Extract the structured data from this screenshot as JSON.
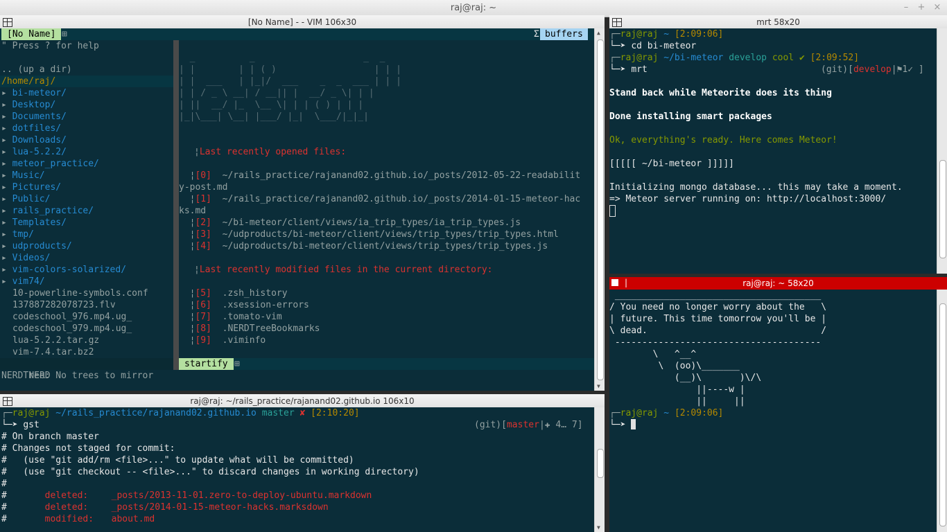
{
  "window": {
    "title": "raj@raj: ~",
    "buttons": [
      "–",
      "+",
      "×"
    ]
  },
  "vim_pane": {
    "title": "[No Name] - - VIM 106x30",
    "top_tab": "[No Name]",
    "buffers_label": "buffers",
    "nerd": {
      "help": "\" Press ? for help",
      "updir": ".. (up a dir)",
      "root": "/home/raj/",
      "dirs": [
        "bi-meteor/",
        "Desktop/",
        "Documents/",
        "dotfiles/",
        "Downloads/",
        "lua-5.2.2/",
        "meteor_practice/",
        "Music/",
        "Pictures/",
        "Public/",
        "rails_practice/",
        "Templates/",
        "tmp/",
        "udproducts/",
        "Videos/",
        "vim-colors-solarized/",
        "vim74/"
      ],
      "files": [
        "10-powerline-symbols.conf",
        "137887282078723.flv",
        "codeschool_976.mp4.ug_",
        "codeschool_979.mp4.ug_",
        "lua-5.2.2.tar.gz",
        "vim-7.4.tar.bz2"
      ],
      "status": "NERD"
    },
    "startify": {
      "banner": [
        "  _          _                    _  _",
        "| |        | | ( )                  | | |",
        "| |  ___   | |_|/  ___    _  _  ___ | | |",
        "| | / _ \\ __| / __|| |  __/ _ \\| | |",
        "| ||  __/ |_  \\__ \\| | | ( ) | | |",
        "|_|\\___| \\__| |___/ |_|  \\___/|_|_|"
      ],
      "recent_header": "Last recently opened files:",
      "recent": [
        {
          "idx": "[0]",
          "text": "~/rails_practice/rajanand02.github.io/_posts/2012-05-22-readabilit"
        },
        {
          "idx": "",
          "text": "y-post.md"
        },
        {
          "idx": "[1]",
          "text": "~/rails_practice/rajanand02.github.io/_posts/2014-01-15-meteor-hac"
        },
        {
          "idx": "",
          "text": "ks.md"
        },
        {
          "idx": "[2]",
          "text": "~/bi-meteor/client/views/ia_trip_types/ia_trip_types.js"
        },
        {
          "idx": "[3]",
          "text": "~/udproducts/bi-meteor/client/views/trip_types/trip_types.html"
        },
        {
          "idx": "[4]",
          "text": "~/udproducts/bi-meteor/client/views/trip_types/trip_types.js"
        }
      ],
      "modified_header": "Last recently modified files in the current directory:",
      "modified": [
        {
          "idx": "[5]",
          "text": ".zsh_history"
        },
        {
          "idx": "[6]",
          "text": ".xsession-errors"
        },
        {
          "idx": "[7]",
          "text": ".tomato-vim"
        },
        {
          "idx": "[8]",
          "text": ".NERDTreeBookmarks"
        },
        {
          "idx": "[9]",
          "text": ".viminfo"
        }
      ],
      "status": "startify"
    },
    "cmdline": "NERDTree: No trees to mirror"
  },
  "mrt_pane": {
    "title": "mrt 58x20",
    "lines": {
      "p1_user": "raj@raj",
      "p1_dir": "~",
      "p1_time": "[2:09:06]",
      "c1": "cd bi-meteor",
      "p2_user": "raj@raj",
      "p2_dir": "~/bi-meteor",
      "p2_branch": "develop",
      "p2_state": "cool ✔",
      "p2_time": "[2:09:52]",
      "c2": "mrt",
      "git_prefix": "(git)[",
      "git_branch": "develop",
      "git_flag": "|⚑1✓ ]",
      "o1": "Stand back while Meteorite does its thing",
      "o2": "Done installing smart packages",
      "o3": "Ok, everything's ready. Here comes Meteor!",
      "o4": "[[[[[ ~/bi-meteor ]]]]]",
      "o5": "Initializing mongo database... this may take a moment.",
      "o6": "=> Meteor server running on: http://localhost:3000/"
    }
  },
  "cow_pane": {
    "title": "raj@raj: ~ 58x20",
    "art": [
      " ______________________________________",
      "/ You need no longer worry about the   \\",
      "| future. This time tomorrow you'll be |",
      "\\ dead.                                /",
      " --------------------------------------",
      "        \\   ^__^",
      "         \\  (oo)\\_______",
      "            (__)\\       )\\/\\",
      "                ||----w |",
      "                ||     ||"
    ],
    "p_user": "raj@raj",
    "p_dir": "~",
    "p_time": "[2:09:06]"
  },
  "git_pane": {
    "title": "raj@raj: ~/rails_practice/rajanand02.github.io 106x10",
    "p_user": "raj@raj",
    "p_dir": "~/rails_practice/rajanand02.github.io",
    "p_branch": "master",
    "p_state": "✘",
    "p_time": "[2:10:20]",
    "cmd": "gst",
    "git_prefix": "(git)[",
    "git_branch": "master",
    "git_rest": "|✚ 4… 7]",
    "lines": [
      "# On branch master",
      "# Changes not staged for commit:",
      "#   (use \"git add/rm <file>...\" to update what will be committed)",
      "#   (use \"git checkout -- <file>...\" to discard changes in working directory)",
      "#"
    ],
    "changes": [
      {
        "kind": "deleted:",
        "file": "_posts/2013-11-01.zero-to-deploy-ubuntu.markdown"
      },
      {
        "kind": "deleted:",
        "file": "_posts/2014-01-15-meteor-hacks.marksdown"
      },
      {
        "kind": "modified:",
        "file": "about.md"
      }
    ]
  },
  "colors": {
    "term_bg": "#0b2d39",
    "prompt_green": "#859900",
    "dir_blue": "#268bd2",
    "branch_cyan": "#2aa198",
    "error_red": "#dc322f",
    "cow_title_bg": "#cc0000"
  }
}
